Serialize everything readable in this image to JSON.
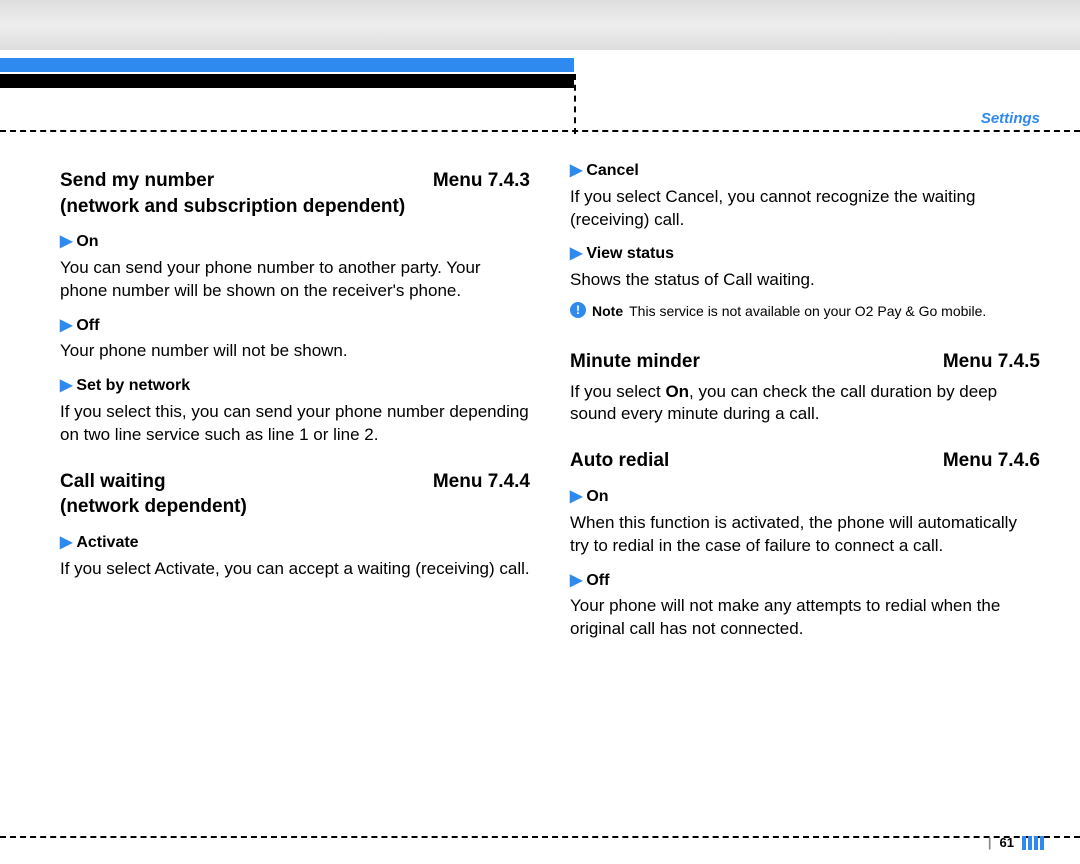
{
  "header": {
    "section": "Settings"
  },
  "left": {
    "s1": {
      "title": "Send my number",
      "menu": "Menu 7.4.3",
      "subtitle": "(network and subscription dependent)",
      "opts": [
        {
          "label": "On",
          "body": "You can send your phone number to another party. Your phone number will be shown on the receiver's phone."
        },
        {
          "label": "Off",
          "body": "Your phone number will not be shown."
        },
        {
          "label": "Set by network",
          "body": "If you select this, you can send your phone number depending on two line service such as line 1 or line 2."
        }
      ]
    },
    "s2": {
      "title": "Call waiting",
      "menu": "Menu 7.4.4",
      "subtitle": "(network dependent)",
      "opts": [
        {
          "label": "Activate",
          "body": "If you select Activate, you can accept a waiting (receiving) call."
        }
      ]
    }
  },
  "right": {
    "s2cont": [
      {
        "label": "Cancel",
        "body": "If you select Cancel, you cannot recognize the waiting (receiving) call."
      },
      {
        "label": "View status",
        "body": "Shows the status of Call waiting."
      }
    ],
    "note": {
      "label": "Note",
      "body": "This service is not available on your O2 Pay & Go mobile."
    },
    "s3": {
      "title": "Minute minder",
      "menu": "Menu 7.4.5",
      "body_prefix": "If you select ",
      "body_bold": "On",
      "body_suffix": ", you can check the call duration by deep sound every minute during a call."
    },
    "s4": {
      "title": "Auto redial",
      "menu": "Menu 7.4.6",
      "opts": [
        {
          "label": "On",
          "body": "When this function is activated, the phone will automatically try to redial in the case of failure to connect a call."
        },
        {
          "label": "Off",
          "body": "Your phone will not make any attempts to redial when the original call has not connected."
        }
      ]
    }
  },
  "footer": {
    "page": "61"
  }
}
